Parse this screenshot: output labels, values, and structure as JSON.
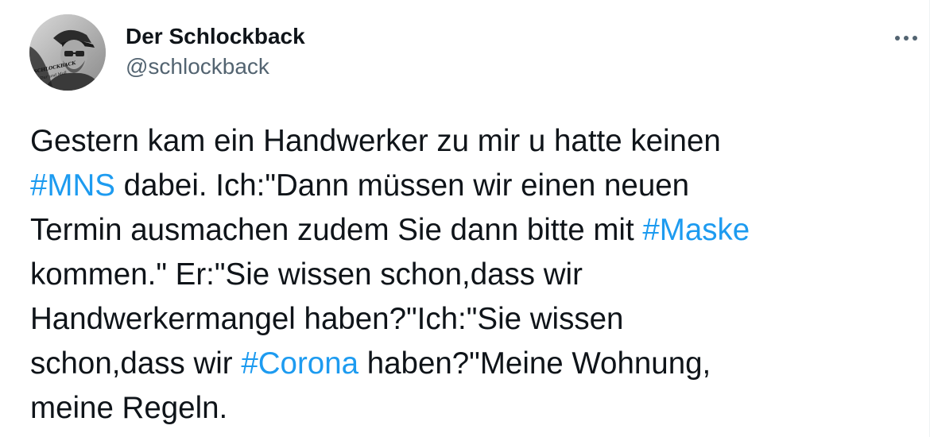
{
  "author": {
    "display_name": "Der Schlockback",
    "handle": "@schlockback",
    "avatar_icon": "user-avatar-photo"
  },
  "more_icon": "more-horizontal-icon",
  "tweet": {
    "lines": [
      [
        {
          "text": "Gestern kam ein Handwerker zu mir u hatte keinen",
          "type": "text"
        }
      ],
      [
        {
          "text": "#MNS",
          "type": "hashtag"
        },
        {
          "text": " dabei. Ich:\"Dann müssen wir einen neuen",
          "type": "text"
        }
      ],
      [
        {
          "text": "Termin ausmachen zudem Sie dann bitte mit ",
          "type": "text"
        },
        {
          "text": "#Maske",
          "type": "hashtag"
        }
      ],
      [
        {
          "text": "kommen.\" Er:\"Sie wissen schon,dass wir",
          "type": "text"
        }
      ],
      [
        {
          "text": "Handwerkermangel haben?\"Ich:\"Sie wissen",
          "type": "text"
        }
      ],
      [
        {
          "text": "schon,dass wir ",
          "type": "text"
        },
        {
          "text": "#Corona",
          "type": "hashtag"
        },
        {
          "text": " haben?\"Meine Wohnung,",
          "type": "text"
        }
      ],
      [
        {
          "text": "meine Regeln.",
          "type": "text"
        }
      ]
    ]
  },
  "colors": {
    "text": "#0f1419",
    "secondary": "#536471",
    "link": "#1d9bf0"
  }
}
